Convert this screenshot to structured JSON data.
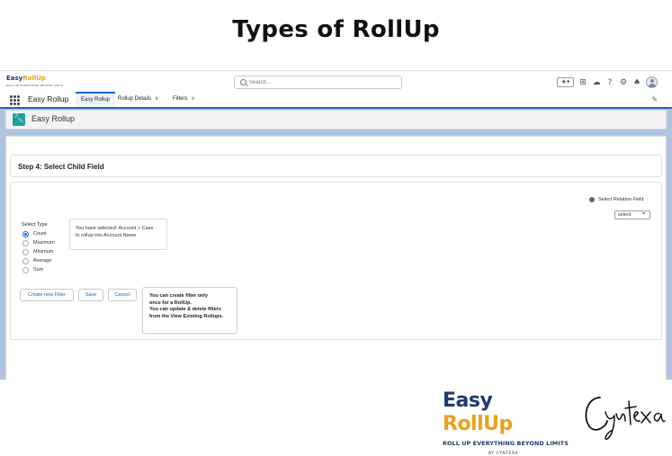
{
  "slide": {
    "title": "Types of RollUp"
  },
  "topbar": {
    "logo_easy": "Easy",
    "logo_rollup": "RollUp",
    "logo_tagline": "ROLL UP EVERYTHING BEYOND LIMITS",
    "search_placeholder": "Search...",
    "favorites_label": "★▾",
    "icons": [
      "favorites-icon",
      "add-icon",
      "setup-assistant-icon",
      "help-icon",
      "settings-icon",
      "notifications-icon",
      "avatar"
    ]
  },
  "navbar": {
    "app_name": "Easy Rollup",
    "tabs": [
      {
        "label": "Easy Rollup",
        "active": true,
        "has_menu": false
      },
      {
        "label": "Rollup Details",
        "active": false,
        "has_menu": true
      },
      {
        "label": "Filters",
        "active": false,
        "has_menu": true
      }
    ]
  },
  "page_header": {
    "title": "Easy Rollup"
  },
  "step": {
    "title": "Step 4: Select Child Field"
  },
  "relation": {
    "label": "Select Relation Field",
    "select_value": "select"
  },
  "select_type": {
    "label": "Select Type",
    "options": [
      {
        "label": "Count",
        "selected": true
      },
      {
        "label": "Maximum",
        "selected": false
      },
      {
        "label": "Minimum",
        "selected": false
      },
      {
        "label": "Average",
        "selected": false
      },
      {
        "label": "Sum",
        "selected": false
      }
    ]
  },
  "selection_info": {
    "line1": "You have selected: Account > Case",
    "line2": "to rollup into Account.Name"
  },
  "buttons": {
    "create_filter": "Create new Filter",
    "save": "Save",
    "cancel": "Cancel"
  },
  "tooltip": {
    "line1": "You can create filter only",
    "line2": "once for a RollUp.",
    "line3": "You can update & delete filters",
    "line4": "from the View Existing Rollups."
  },
  "brand": {
    "name_easy": "Easy ",
    "name_rollup": "RollUp",
    "tagline": "ROLL UP EVERYTHING BEYOND LIMITS",
    "by": "BY CYNTEXA",
    "signature": "Cyntexa"
  },
  "colors": {
    "brand_navy": "#1e3a6e",
    "brand_gold": "#e9a21b",
    "sf_blue": "#1b66c9",
    "header_teal": "#19a59a",
    "backdrop": "#b0c4df"
  }
}
